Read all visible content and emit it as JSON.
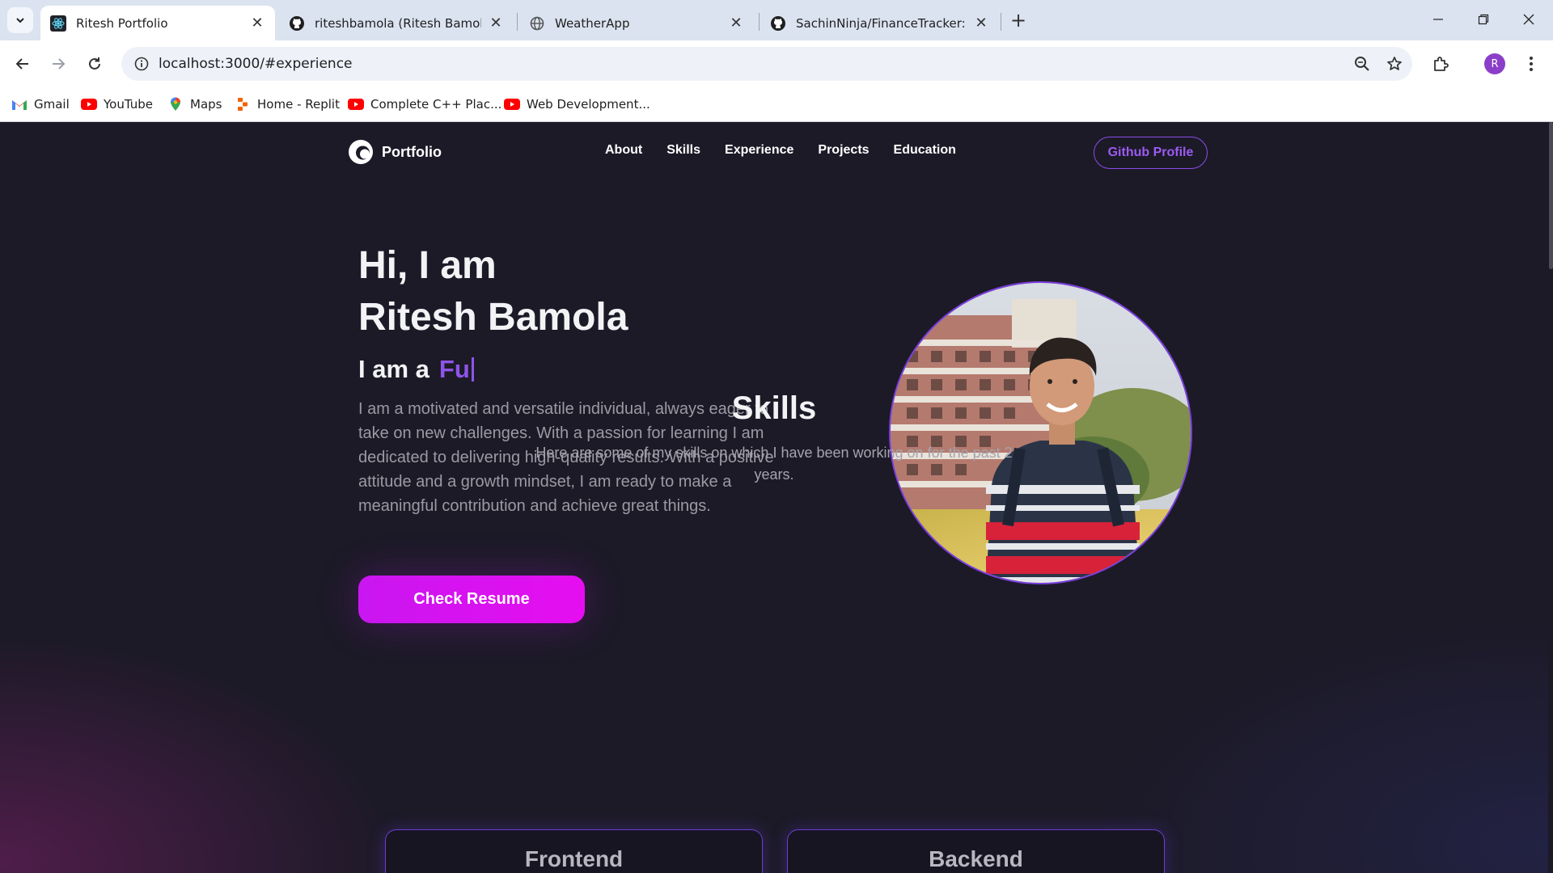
{
  "browser": {
    "tabs": [
      {
        "title": "Ritesh Portfolio",
        "active": true
      },
      {
        "title": "riteshbamola (Ritesh Bamola)",
        "active": false
      },
      {
        "title": "WeatherApp",
        "active": false
      },
      {
        "title": "SachinNinja/FinanceTracker: Fin",
        "active": false
      }
    ],
    "url": "localhost:3000/#experience",
    "profile_initial": "R",
    "bookmarks": [
      "Gmail",
      "YouTube",
      "Maps",
      "Home - Replit",
      "Complete C++ Plac...",
      "Web Development..."
    ]
  },
  "site": {
    "brand": "Portfolio",
    "nav": [
      "About",
      "Skills",
      "Experience",
      "Projects",
      "Education"
    ],
    "github_button": "Github Profile",
    "hero": {
      "line1": "Hi, I am",
      "line2": "Ritesh Bamola",
      "role_prefix": "I am a",
      "role_typed": "Fu",
      "description": "I am a motivated and versatile individual, always eager to take on new challenges. With a passion for learning I am dedicated to delivering high-quality results. With a positive attitude and a growth mindset, I am ready to make a meaningful contribution and achieve great things.",
      "resume_button": "Check Resume"
    },
    "skills": {
      "title": "Skills",
      "subtitle": "Here are some of my skills on which I have been working on for the past 2 years.",
      "cards": [
        "Frontend",
        "Backend"
      ]
    }
  },
  "colors": {
    "accent_purple": "#8e54e9",
    "button_magenta": "#d513f0",
    "page_bg": "#1c1a27"
  }
}
